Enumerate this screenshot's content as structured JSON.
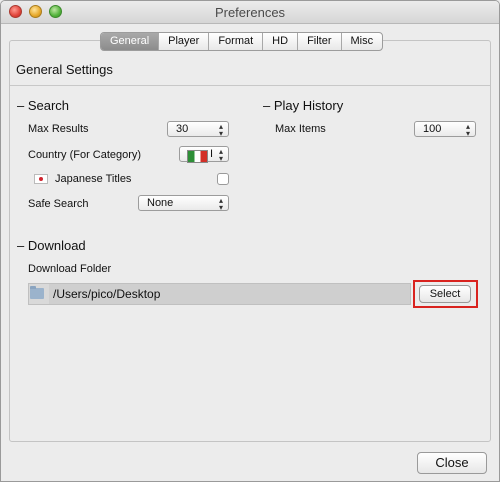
{
  "window": {
    "title": "Preferences"
  },
  "tabs": [
    {
      "label": "General",
      "active": true
    },
    {
      "label": "Player",
      "active": false
    },
    {
      "label": "Format",
      "active": false
    },
    {
      "label": "HD",
      "active": false
    },
    {
      "label": "Filter",
      "active": false
    },
    {
      "label": "Misc",
      "active": false
    }
  ],
  "panel": {
    "title": "General Settings"
  },
  "search": {
    "heading": "– Search",
    "max_results_label": "Max Results",
    "max_results_value": "30",
    "country_label": "Country (For Category)",
    "country_value": "I",
    "japanese_titles_label": "Japanese Titles",
    "japanese_titles_checked": false,
    "safe_search_label": "Safe Search",
    "safe_search_value": "None"
  },
  "play_history": {
    "heading": "– Play History",
    "max_items_label": "Max Items",
    "max_items_value": "100"
  },
  "download": {
    "heading": "– Download",
    "folder_label": "Download Folder",
    "folder_path": "/Users/pico/Desktop",
    "select_label": "Select"
  },
  "footer": {
    "close_label": "Close"
  },
  "colors": {
    "highlight": "#d9231f",
    "active_tab": "#8c8c8c"
  }
}
